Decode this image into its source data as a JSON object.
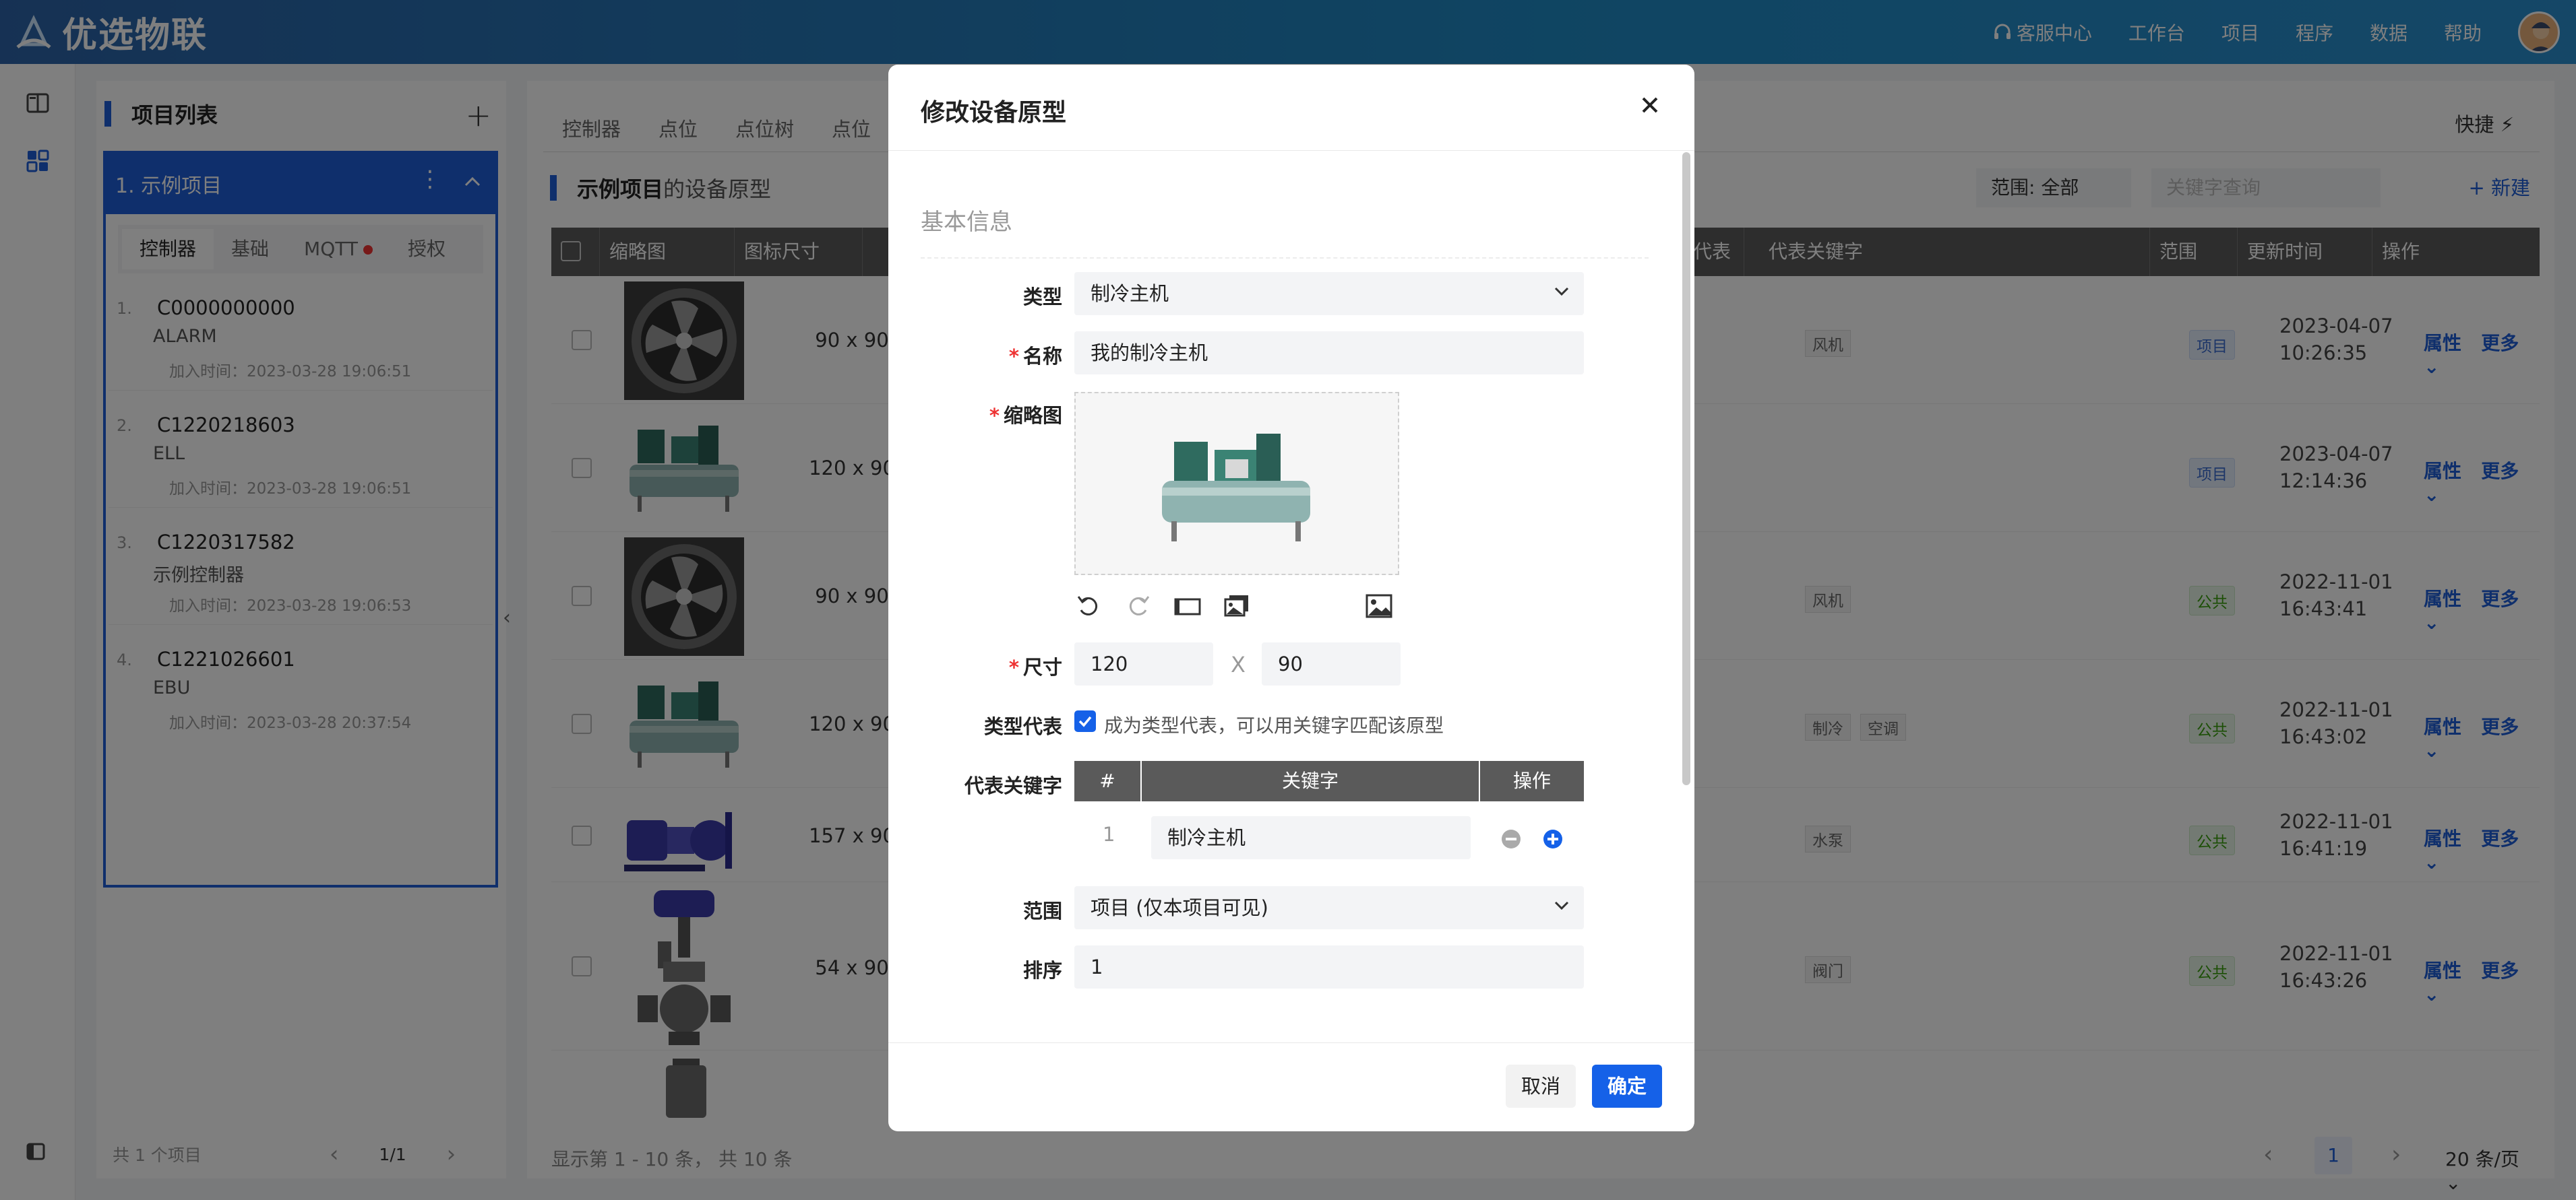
{
  "app": {
    "title": "优选物联"
  },
  "topnav": {
    "items": [
      "客服中心",
      "工作台",
      "项目",
      "程序",
      "数据",
      "帮助"
    ]
  },
  "project_panel": {
    "title": "项目列表",
    "project": "1. 示例项目",
    "tabs": [
      "控制器",
      "基础",
      "MQTT",
      "授权"
    ],
    "controllers": [
      {
        "num": "1.",
        "code": "C0000000000",
        "name": "ALARM",
        "date": "加入时间：2023-03-28 19:06:51"
      },
      {
        "num": "2.",
        "code": "C1220218603",
        "name": "ELL",
        "date": "加入时间：2023-03-28 19:06:51"
      },
      {
        "num": "3.",
        "code": "C1220317582",
        "name": "示例控制器",
        "date": "加入时间：2023-03-28 19:06:53"
      },
      {
        "num": "4.",
        "code": "C1221026601",
        "name": "EBU",
        "date": "加入时间：2023-03-28 20:37:54"
      }
    ],
    "footer": {
      "count": "共 1 个项目",
      "page": "1/1"
    }
  },
  "main": {
    "tabs": [
      "控制器",
      "点位",
      "点位树",
      "点位"
    ],
    "quick": "快捷",
    "list_title_strong": "示例项目",
    "list_title_rest": "的设备原型",
    "range_filter": "范围: 全部",
    "search_placeholder": "关键字查询",
    "new_btn": "+ 新建",
    "columns": [
      "缩略图",
      "图标尺寸",
      "代表",
      "代表关键字",
      "范围",
      "更新时间",
      "操作"
    ],
    "rows": [
      {
        "size": "90 x 90",
        "kw": [
          "风机"
        ],
        "scope": "项目",
        "date1": "2023-04-07",
        "date2": "10:26:35"
      },
      {
        "size": "120 x 90",
        "kw": [],
        "scope": "项目",
        "date1": "2023-04-07",
        "date2": "12:14:36"
      },
      {
        "size": "90 x 90",
        "kw": [
          "风机"
        ],
        "scope": "公共",
        "date1": "2022-11-01",
        "date2": "16:43:41"
      },
      {
        "size": "120 x 90",
        "kw": [
          "制冷",
          "空调"
        ],
        "scope": "公共",
        "date1": "2022-11-01",
        "date2": "16:43:02"
      },
      {
        "size": "157 x 90",
        "kw": [
          "水泵"
        ],
        "scope": "公共",
        "date1": "2022-11-01",
        "date2": "16:41:19"
      },
      {
        "size": "54 x 90",
        "kw": [
          "阀门"
        ],
        "scope": "公共",
        "date1": "2022-11-01",
        "date2": "16:43:26"
      }
    ],
    "op_attr": "属性",
    "op_more": "更多",
    "footer_info": "显示第 1 - 10 条， 共 10 条",
    "current_page": "1",
    "page_size": "20 条/页"
  },
  "dialog": {
    "title": "修改设备原型",
    "section": "基本信息",
    "type_label": "类型",
    "type_value": "制冷主机",
    "name_label": "名称",
    "name_value": "我的制冷主机",
    "thumb_label": "缩略图",
    "size_label": "尺寸",
    "width": "120",
    "x": "X",
    "height": "90",
    "rep_label": "类型代表",
    "rep_text": "成为类型代表，可以用关键字匹配该原型",
    "kw_label": "代表关键字",
    "kw_table": {
      "cols": [
        "#",
        "关键字",
        "操作"
      ],
      "rows": [
        {
          "n": "1",
          "kw": "制冷主机"
        }
      ]
    },
    "scope_label": "范围",
    "scope_value": "项目 (仅本项目可见)",
    "order_label": "排序",
    "order_value": "1",
    "cancel": "取消",
    "ok": "确定"
  }
}
